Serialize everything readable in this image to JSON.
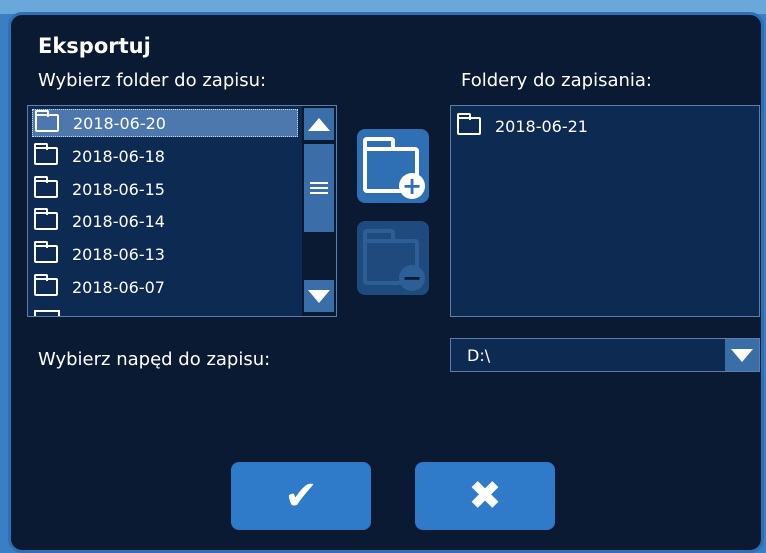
{
  "dialog": {
    "title": "Eksportuj",
    "source_label": "Wybierz folder do zapisu:",
    "dest_label": "Foldery do zapisania:",
    "drive_label": "Wybierz napęd do zapisu:"
  },
  "source_folders": [
    {
      "name": "2018-06-20",
      "selected": true
    },
    {
      "name": "2018-06-18",
      "selected": false
    },
    {
      "name": "2018-06-15",
      "selected": false
    },
    {
      "name": "2018-06-14",
      "selected": false
    },
    {
      "name": "2018-06-13",
      "selected": false
    },
    {
      "name": "2018-06-07",
      "selected": false
    }
  ],
  "dest_folders": [
    {
      "name": "2018-06-21"
    }
  ],
  "drive": {
    "selected": "D:\\"
  },
  "icons": {
    "add": "add-folder-icon",
    "remove": "remove-folder-icon",
    "ok": "checkmark-icon",
    "cancel": "close-icon",
    "scroll_up": "triangle-up-icon",
    "scroll_down": "triangle-down-icon",
    "dropdown": "chevron-down-icon"
  },
  "colors": {
    "background": "#0b1a33",
    "accent": "#2f7ac9",
    "selection": "#4d78ad"
  }
}
